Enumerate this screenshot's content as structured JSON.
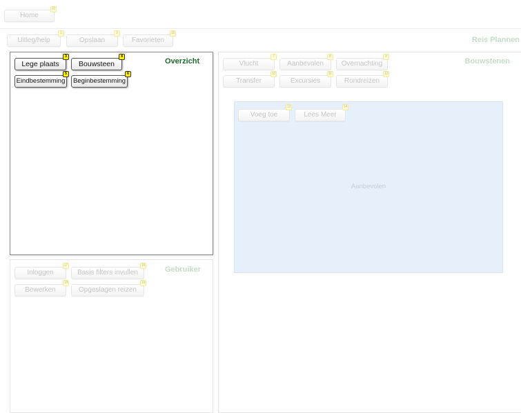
{
  "top": {
    "home_label": "Home",
    "home_badge": "20"
  },
  "toolbar": {
    "title": "Reis Plannen",
    "buttons": [
      {
        "label": "Uitleg/help",
        "badge": "1"
      },
      {
        "label": "Opslaan",
        "badge": "2"
      },
      {
        "label": "Favorieten",
        "badge": "15"
      }
    ]
  },
  "overzicht": {
    "title": "Overzicht",
    "buttons": [
      {
        "label": "Lege plaats",
        "badge": "3"
      },
      {
        "label": "Bouwsteen",
        "badge": "4"
      },
      {
        "label": "Eindbestemming",
        "badge": "5"
      },
      {
        "label": "Beginbestemming",
        "badge": "6"
      }
    ]
  },
  "gebruiker": {
    "title": "Gebruiker",
    "buttons": [
      {
        "label": "Inloggen",
        "badge": "17"
      },
      {
        "label": "Basis filters invullen",
        "badge": "16"
      },
      {
        "label": "Bewerken",
        "badge": "18"
      },
      {
        "label": "Opgeslagen reizen",
        "badge": "19"
      }
    ]
  },
  "bouwstenen": {
    "title": "Bouwstenen",
    "buttons": [
      {
        "label": "Vlucht",
        "badge": "7"
      },
      {
        "label": "Aanbevolen",
        "badge": "8"
      },
      {
        "label": "Overnachting",
        "badge": "9"
      },
      {
        "label": "Transfer",
        "badge": "10"
      },
      {
        "label": "Excursies",
        "badge": "11"
      },
      {
        "label": "Rondreizen",
        "badge": "12"
      }
    ],
    "content": {
      "label": "Aanbevolen",
      "buttons": [
        {
          "label": "Voeg toe",
          "badge": "13"
        },
        {
          "label": "Lees Meer",
          "badge": "14"
        }
      ]
    }
  },
  "colors": {
    "active_title": "#1d6b2e",
    "inactive_title": "#c4ddc8",
    "content_bg": "#e5f0fb",
    "badge_active": "#ffee00",
    "badge_inactive": "#fffbd9"
  }
}
